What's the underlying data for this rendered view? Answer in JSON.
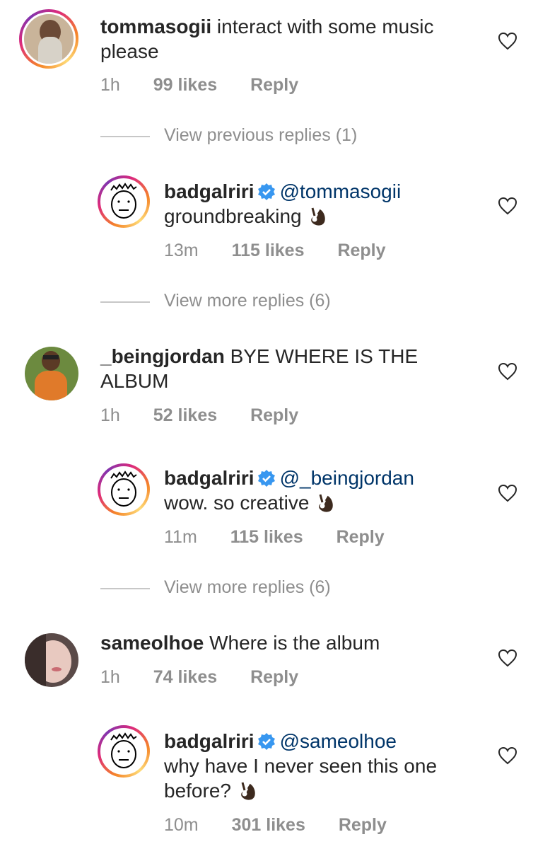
{
  "comments": [
    {
      "user": "tommasogii",
      "text": "interact with some music please",
      "time": "1h",
      "likes": "99 likes",
      "reply": "Reply"
    },
    {
      "user": "badgalriri",
      "mention": "@tommasogii",
      "text": "groundbreaking",
      "time": "13m",
      "likes": "115 likes",
      "reply": "Reply"
    },
    {
      "user": "_beingjordan",
      "text": "BYE WHERE IS THE ALBUM",
      "time": "1h",
      "likes": "52 likes",
      "reply": "Reply"
    },
    {
      "user": "badgalriri",
      "mention": "@_beingjordan",
      "text": "wow. so creative",
      "time": "11m",
      "likes": "115 likes",
      "reply": "Reply"
    },
    {
      "user": "sameolhoe",
      "text": "Where is the album",
      "time": "1h",
      "likes": "74 likes",
      "reply": "Reply"
    },
    {
      "user": "badgalriri",
      "mention": "@sameolhoe",
      "text": "why have I never seen this one before?",
      "time": "10m",
      "likes": "301 likes",
      "reply": "Reply"
    }
  ],
  "view_replies": [
    "View previous replies (1)",
    "View more replies (6)",
    "View more replies (6)"
  ],
  "icons": {
    "heart": "heart-outline-icon",
    "verified": "verified-badge-icon",
    "emoji": "ok-hand-emoji"
  },
  "colors": {
    "meta_gray": "#8e8e8e",
    "mention_blue": "#003569",
    "verified_blue": "#3897f0"
  }
}
